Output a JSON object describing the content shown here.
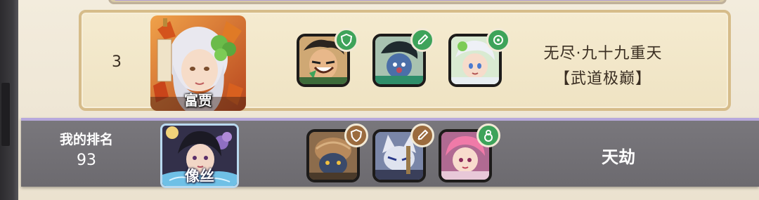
{
  "leaderboard": {
    "entry": {
      "rank": "3",
      "player_name": "富贾",
      "title_line1": "无尽·九十九重天",
      "title_line2": "【武道极巅】"
    },
    "my_entry": {
      "label": "我的排名",
      "rank": "93",
      "player_name": "像丝",
      "title": "天劫"
    }
  },
  "colors": {
    "card_bg": "#efe3c3",
    "card_border": "#d6bc8a",
    "my_card_bg": "#737176",
    "badge_green": "#3ea35a",
    "badge_brown": "#9b6b3e"
  },
  "icons": {
    "entry_heroes": [
      "warrior-hero-portrait",
      "green-robed-hero-portrait",
      "silver-haired-hero-portrait"
    ],
    "entry_badges": [
      "shield-badge-icon",
      "sword-badge-icon",
      "swirl-badge-icon"
    ],
    "my_heroes": [
      "beast-hero-portrait",
      "masked-fox-hero-portrait",
      "pink-haired-hero-portrait"
    ],
    "my_badges": [
      "shield-badge-icon",
      "sword-badge-icon",
      "gourd-badge-icon"
    ]
  }
}
